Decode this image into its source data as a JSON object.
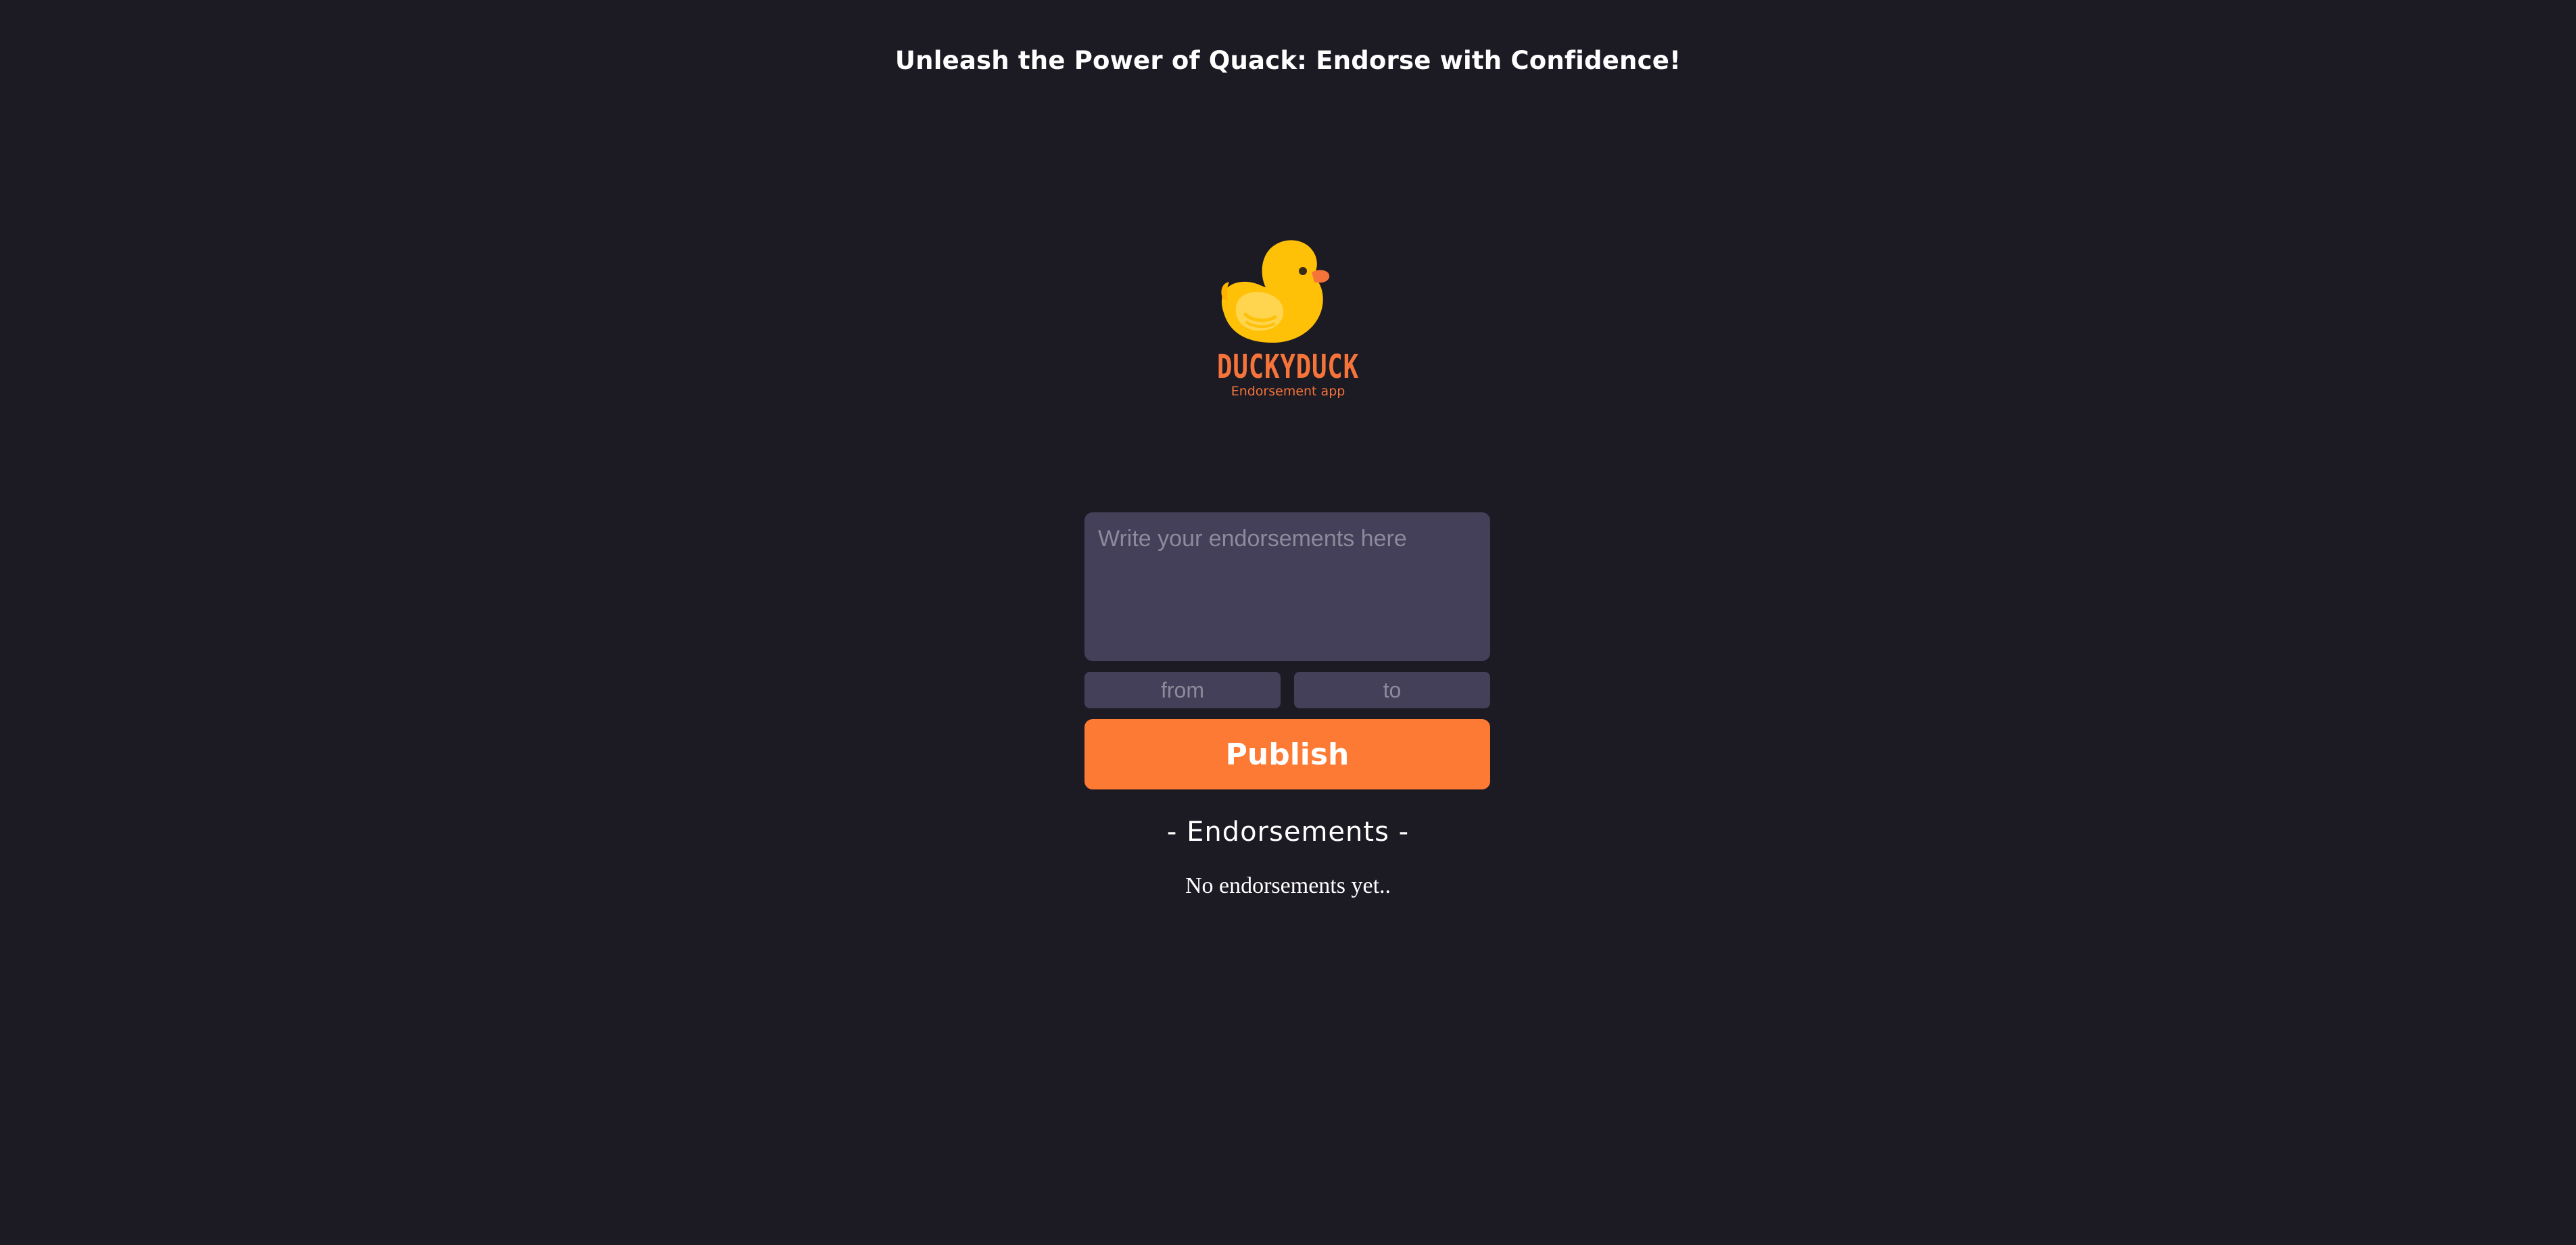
{
  "header": {
    "headline": "Unleash the Power of Quack: Endorse with Confidence!"
  },
  "logo": {
    "title": "DUCKYDUCK",
    "subtitle": "Endorsement app",
    "icon": "rubber-duck-icon",
    "colors": {
      "duck_body": "#ffc107",
      "duck_wing": "#ffd54f",
      "beak": "#f6743a",
      "text": "#f6743a"
    }
  },
  "form": {
    "endorsement_placeholder": "Write your endorsements here",
    "endorsement_value": "",
    "from_placeholder": "from",
    "from_value": "",
    "to_placeholder": "to",
    "to_value": "",
    "publish_label": "Publish"
  },
  "endorsements": {
    "title": "- Endorsements -",
    "empty_message": "No endorsements yet..",
    "items": []
  },
  "colors": {
    "background": "#1c1a23",
    "input_background": "#444059",
    "accent": "#fd7a35",
    "text": "#ffffff"
  }
}
